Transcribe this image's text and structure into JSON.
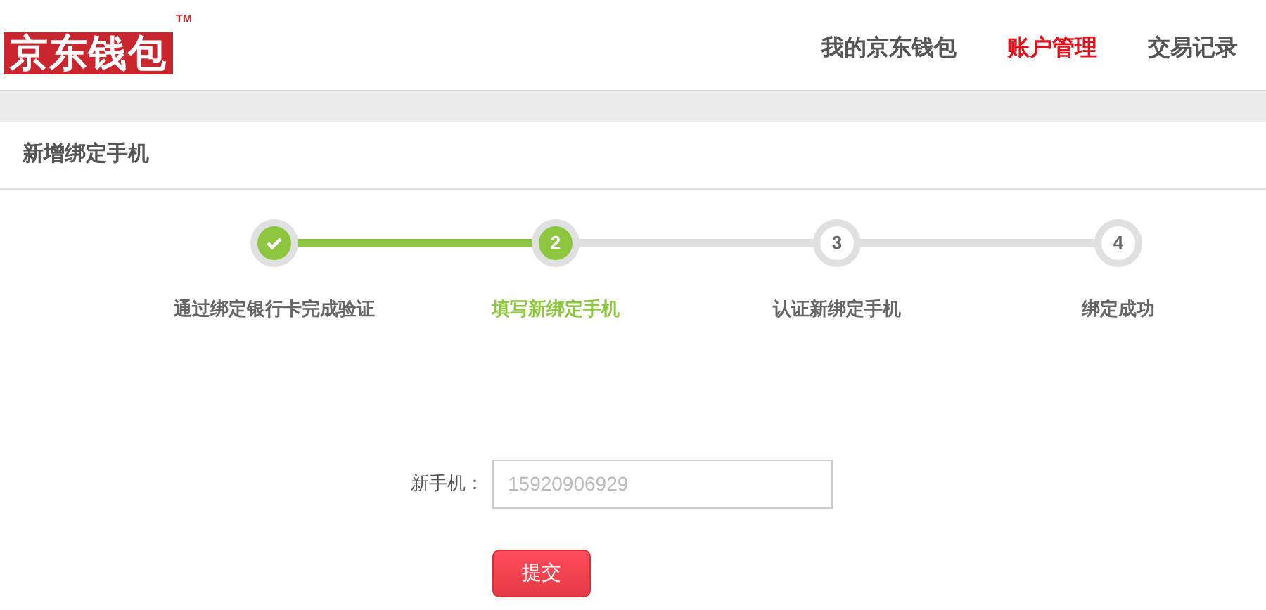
{
  "logo": {
    "text": "京东钱包",
    "mark": "TM"
  },
  "nav": [
    {
      "label": "我的京东钱包",
      "selected": false
    },
    {
      "label": "账户管理",
      "selected": true
    },
    {
      "label": "交易记录",
      "selected": false
    }
  ],
  "section_title": "新增绑定手机",
  "steps": [
    {
      "label": "通过绑定银行卡完成验证",
      "kind": "done"
    },
    {
      "number": "2",
      "label": "填写新绑定手机",
      "kind": "current"
    },
    {
      "number": "3",
      "label": "认证新绑定手机",
      "kind": "pending"
    },
    {
      "number": "4",
      "label": "绑定成功",
      "kind": "pending"
    }
  ],
  "form": {
    "label": "新手机：",
    "placeholder": "15920906929",
    "submit": "提交"
  }
}
